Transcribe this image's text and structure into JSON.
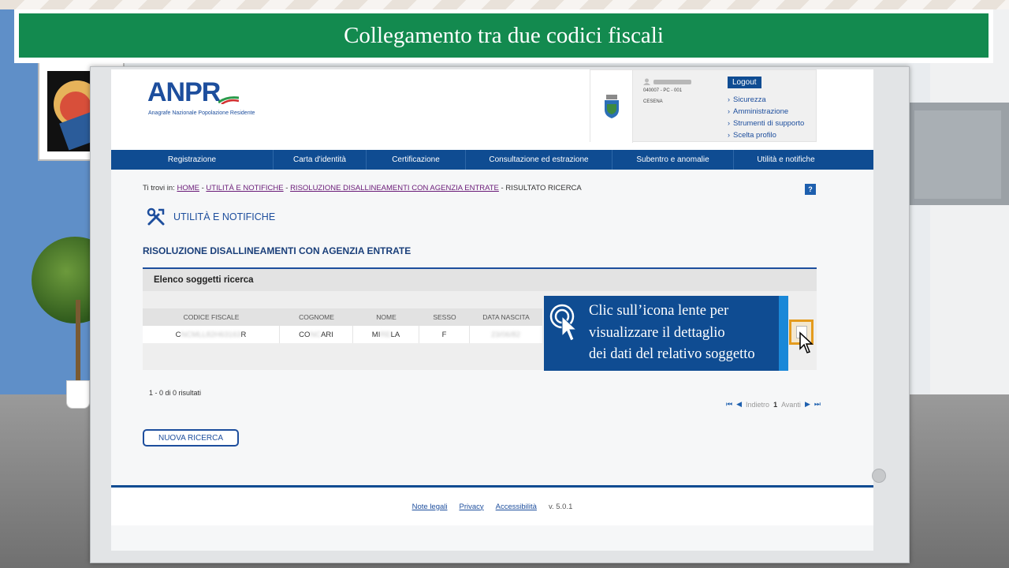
{
  "banner": {
    "title": "Collegamento tra due codici fiscali"
  },
  "header": {
    "logo_text": "ANPR",
    "logo_subtitle": "Anagrafe Nazionale Popolazione Residente",
    "user_code": "040007 - PC - 001",
    "city": "CESENA",
    "logout_label": "Logout",
    "menu": [
      "Sicurezza",
      "Amministrazione",
      "Strumenti di supporto",
      "Scelta profilo"
    ]
  },
  "nav": {
    "items": [
      "Registrazione",
      "Carta d'identità",
      "Certificazione",
      "Consultazione ed estrazione",
      "Subentro e anomalie",
      "Utilità e notifiche"
    ]
  },
  "breadcrumb": {
    "prefix": "Ti trovi in:",
    "home": "HOME",
    "sep1": " - ",
    "item1": "UTILITÀ E NOTIFICHE",
    "sep2": " - ",
    "item2": "RISOLUZIONE DISALLINEAMENTI CON AGENZIA ENTRATE",
    "current": " - RISULTATO RICERCA"
  },
  "section": {
    "title": "UTILITÀ E NOTIFICHE"
  },
  "page": {
    "title": "RISOLUZIONE DISALLINEAMENTI CON AGENZIA ENTRATE"
  },
  "results": {
    "title": "Elenco soggetti ricerca",
    "columns": [
      "CODICE FISCALE",
      "COGNOME",
      "NOME",
      "SESSO",
      "DATA NASCITA"
    ],
    "row": {
      "cf_start": "C",
      "cf_end": "R",
      "cf_mid": "NCMLL82H63163",
      "cognome_start": "CO",
      "cognome_mid": "NC",
      "cognome_end": "ARI",
      "nome_start": "MI",
      "nome_mid": "RE",
      "nome_end": "LA",
      "sesso": "F",
      "data": "23/06/82"
    },
    "count": "1 - 0 di 0 risultati"
  },
  "pager": {
    "prev": "Indietro",
    "current": "1",
    "next": "Avanti"
  },
  "actions": {
    "new_search": "NUOVA RICERCA"
  },
  "footer": {
    "legal": "Note legali",
    "privacy": "Privacy",
    "accessibility": "Accessibilità",
    "version": "v. 5.0.1"
  },
  "callout": {
    "line1": "Clic sull’icona lente per",
    "line2": "visualizzare il dettaglio",
    "line3": "dei dati del relativo soggetto"
  },
  "colors": {
    "banner": "#138a4f",
    "nav": "#0f4c92",
    "callout": "#0f4c92",
    "highlight": "#e49b1e"
  }
}
